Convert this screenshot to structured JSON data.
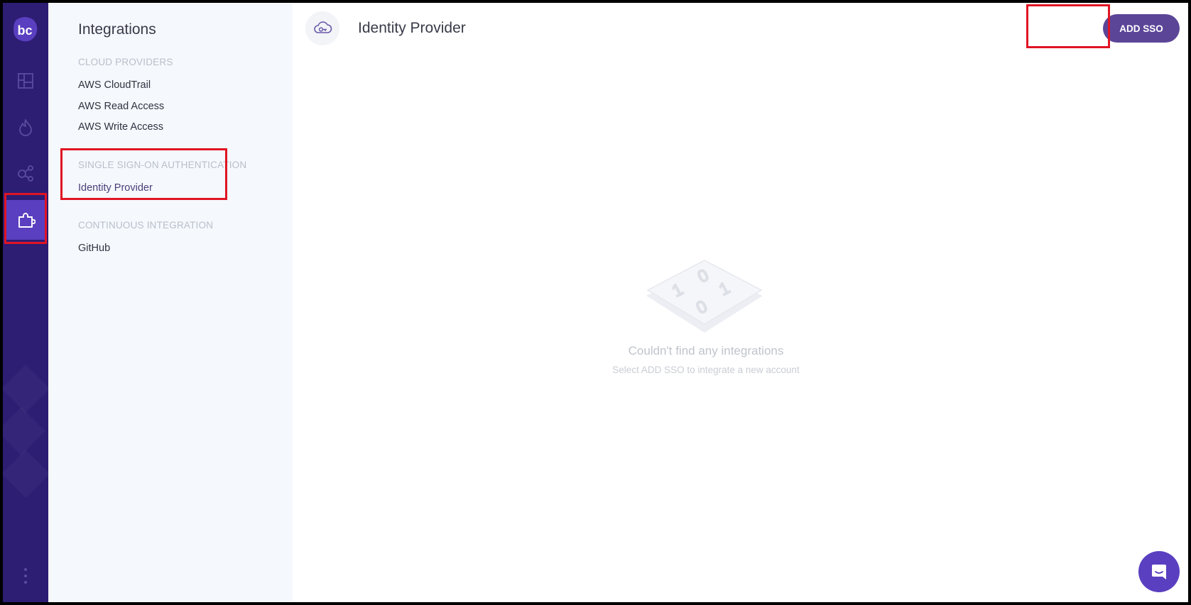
{
  "app": {
    "logo_text": "bc",
    "brand_color": "#2d1d73",
    "accent_color": "#5a3fc0",
    "highlight_color": "#e01424"
  },
  "rail": {
    "items": [
      {
        "icon": "dashboard-icon",
        "active": false
      },
      {
        "icon": "flame-icon",
        "active": false
      },
      {
        "icon": "graph-icon",
        "active": false
      },
      {
        "icon": "puzzle-icon",
        "active": true
      }
    ],
    "more_icon": "more-vertical-icon"
  },
  "sidebar": {
    "title": "Integrations",
    "groups": [
      {
        "label": "CLOUD PROVIDERS",
        "items": [
          "AWS CloudTrail",
          "AWS Read Access",
          "AWS Write Access"
        ]
      },
      {
        "label": "SINGLE SIGN-ON AUTHENTICATION",
        "items": [
          "Identity Provider"
        ]
      },
      {
        "label": "CONTINUOUS INTEGRATION",
        "items": [
          "GitHub"
        ]
      }
    ],
    "active_item": "Identity Provider"
  },
  "main": {
    "header_icon": "cloud-key-icon",
    "title": "Identity Provider",
    "add_button": "ADD SSO",
    "empty_state": {
      "title": "Couldn't find any integrations",
      "subtitle": "Select ADD SSO to integrate a new account",
      "illustration_digits": [
        "0",
        "1",
        "1",
        "0"
      ]
    },
    "chat_icon": "chat-icon"
  }
}
